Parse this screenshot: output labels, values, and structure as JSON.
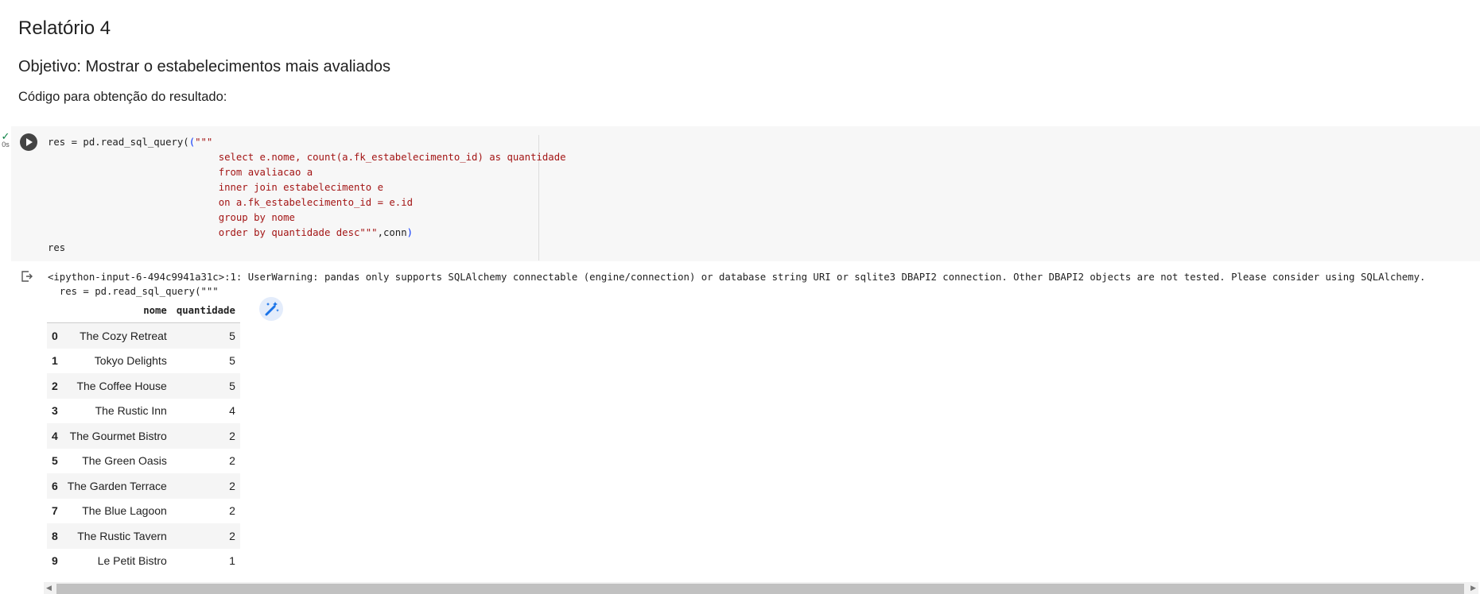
{
  "heading": "Relatório 4",
  "objective": "Objetivo: Mostrar o estabelecimentos mais avaliados",
  "code_intro": "Código para obtenção do resultado:",
  "cell": {
    "status_check": "✓",
    "exec_time": "0s",
    "code_line1_a": "res = pd.read_sql_query(",
    "code_line1_b": "\"\"\"",
    "sql_lines": [
      "select e.nome, count(a.fk_estabelecimento_id) as quantidade",
      "from avaliacao a",
      "inner join estabelecimento e",
      "on a.fk_estabelecimento_id = e.id",
      "group by nome",
      "order by quantidade desc\"\"\""
    ],
    "code_tail": ",conn",
    "code_close": ")",
    "code_last": "res"
  },
  "output": {
    "warning_line1": "<ipython-input-6-494c9941a31c>:1: UserWarning: pandas only supports SQLAlchemy connectable (engine/connection) or database string URI or sqlite3 DBAPI2 connection. Other DBAPI2 objects are not tested. Please consider using SQLAlchemy.",
    "warning_line2": "  res = pd.read_sql_query(\"\"\"",
    "table": {
      "columns": [
        "",
        "nome",
        "quantidade"
      ],
      "rows": [
        [
          "0",
          "The Cozy Retreat",
          "5"
        ],
        [
          "1",
          "Tokyo Delights",
          "5"
        ],
        [
          "2",
          "The Coffee House",
          "5"
        ],
        [
          "3",
          "The Rustic Inn",
          "4"
        ],
        [
          "4",
          "The Gourmet Bistro",
          "2"
        ],
        [
          "5",
          "The Green Oasis",
          "2"
        ],
        [
          "6",
          "The Garden Terrace",
          "2"
        ],
        [
          "7",
          "The Blue Lagoon",
          "2"
        ],
        [
          "8",
          "The Rustic Tavern",
          "2"
        ],
        [
          "9",
          "Le Petit Bistro",
          "1"
        ]
      ]
    },
    "wand_icon": "magic-wand-icon"
  },
  "colors": {
    "string": "#a31515",
    "accent": "#1a73e8"
  }
}
